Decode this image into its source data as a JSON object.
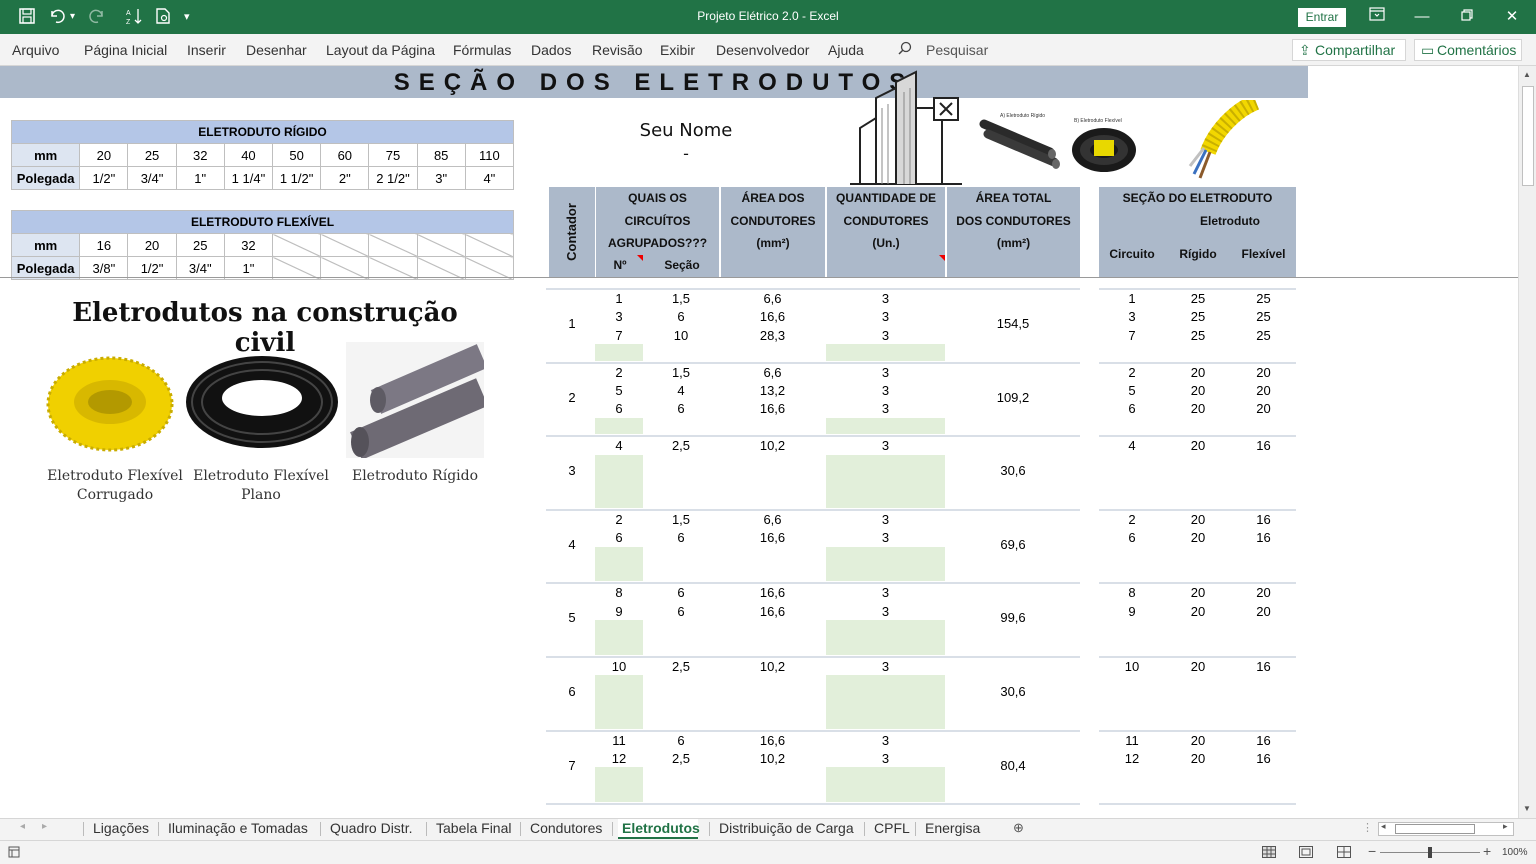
{
  "app": {
    "title": "Projeto Elétrico 2.0  -  Excel",
    "login_label": "Entrar"
  },
  "ribbon": {
    "items": [
      "Arquivo",
      "Página Inicial",
      "Inserir",
      "Desenhar",
      "Layout da Página",
      "Fórmulas",
      "Dados",
      "Revisão",
      "Exibir",
      "Desenvolvedor",
      "Ajuda"
    ],
    "search_label": "Pesquisar",
    "share_label": "Compartilhar",
    "comments_label": "Comentários"
  },
  "sheet": {
    "banner": "SEÇÃO DOS ELETRODUTOS",
    "seu_nome": "Seu Nome",
    "seu_nome_sub": "-",
    "rigido": {
      "title": "ELETRODUTO RÍGIDO",
      "mm_label": "mm",
      "pol_label": "Polegada",
      "mm": [
        "20",
        "25",
        "32",
        "40",
        "50",
        "60",
        "75",
        "85",
        "110"
      ],
      "pol": [
        "1/2\"",
        "3/4\"",
        "1\"",
        "1 1/4\"",
        "1 1/2\"",
        "2\"",
        "2 1/2\"",
        "3\"",
        "4\""
      ]
    },
    "flexivel": {
      "title": "ELETRODUTO FLEXÍVEL",
      "mm_label": "mm",
      "pol_label": "Polegada",
      "mm": [
        "16",
        "20",
        "25",
        "32"
      ],
      "pol": [
        "3/8\"",
        "1/2\"",
        "3/4\"",
        "1\""
      ]
    },
    "construcao": {
      "title": "Eletrodutos na construção civil",
      "caption1a": "Eletroduto Flexível",
      "caption1b": "Corrugado",
      "caption2a": "Eletroduto Flexível",
      "caption2b": "Plano",
      "caption3": "Eletroduto Rígido"
    },
    "photo_labels": {
      "rigido": "A) Eletroduto Rígido",
      "flexivel": "B) Eletroduto Flexível"
    },
    "headers": {
      "contador": "Contador",
      "quais_1": "QUAIS OS",
      "quais_2": "CIRCUÍTOS",
      "quais_3": "AGRUPADOS???",
      "num": "Nº",
      "secao": "Seção",
      "area_1": "ÁREA DOS",
      "area_2": "CONDUTORES",
      "area_3": "(mm²)",
      "qtd_1": "QUANTIDADE DE",
      "qtd_2": "CONDUTORES",
      "qtd_3": "(Un.)",
      "total_1": "ÁREA TOTAL",
      "total_2": "DOS CONDUTORES",
      "total_3": "(mm²)",
      "secao_eletroduto": "SEÇÃO DO ELETRODUTO",
      "eletroduto": "Eletroduto",
      "circuito": "Circuito",
      "rigido": "Rígido",
      "flexivel": "Flexível"
    },
    "groups": [
      {
        "contador": "1",
        "total": "154,5",
        "rows": [
          [
            "1",
            "1,5",
            "6,6",
            "3"
          ],
          [
            "3",
            "6",
            "16,6",
            "3"
          ],
          [
            "7",
            "10",
            "28,3",
            "3"
          ]
        ],
        "sec": [
          [
            "1",
            "25",
            "25"
          ],
          [
            "3",
            "25",
            "25"
          ],
          [
            "7",
            "25",
            "25"
          ]
        ]
      },
      {
        "contador": "2",
        "total": "109,2",
        "rows": [
          [
            "2",
            "1,5",
            "6,6",
            "3"
          ],
          [
            "5",
            "4",
            "13,2",
            "3"
          ],
          [
            "6",
            "6",
            "16,6",
            "3"
          ]
        ],
        "sec": [
          [
            "2",
            "20",
            "20"
          ],
          [
            "5",
            "20",
            "20"
          ],
          [
            "6",
            "20",
            "20"
          ]
        ]
      },
      {
        "contador": "3",
        "total": "30,6",
        "rows": [
          [
            "4",
            "2,5",
            "10,2",
            "3"
          ]
        ],
        "sec": [
          [
            "4",
            "20",
            "16"
          ]
        ]
      },
      {
        "contador": "4",
        "total": "69,6",
        "rows": [
          [
            "2",
            "1,5",
            "6,6",
            "3"
          ],
          [
            "6",
            "6",
            "16,6",
            "3"
          ]
        ],
        "sec": [
          [
            "2",
            "20",
            "16"
          ],
          [
            "6",
            "20",
            "16"
          ]
        ]
      },
      {
        "contador": "5",
        "total": "99,6",
        "rows": [
          [
            "8",
            "6",
            "16,6",
            "3"
          ],
          [
            "9",
            "6",
            "16,6",
            "3"
          ]
        ],
        "sec": [
          [
            "8",
            "20",
            "20"
          ],
          [
            "9",
            "20",
            "20"
          ]
        ]
      },
      {
        "contador": "6",
        "total": "30,6",
        "rows": [
          [
            "10",
            "2,5",
            "10,2",
            "3"
          ]
        ],
        "sec": [
          [
            "10",
            "20",
            "16"
          ]
        ]
      },
      {
        "contador": "7",
        "total": "80,4",
        "rows": [
          [
            "11",
            "6",
            "16,6",
            "3"
          ],
          [
            "12",
            "2,5",
            "10,2",
            "3"
          ]
        ],
        "sec": [
          [
            "11",
            "20",
            "16"
          ],
          [
            "12",
            "20",
            "16"
          ]
        ]
      }
    ]
  },
  "tabs": {
    "items": [
      "Ligações",
      "Iluminação e Tomadas",
      "Quadro Distr.",
      "Tabela Final",
      "Condutores",
      "Eletrodutos",
      "Distribuição de Carga",
      "CPFL",
      "Energisa"
    ],
    "active": "Eletrodutos"
  },
  "status": {
    "zoom": "100%"
  },
  "colors": {
    "excel_green": "#217346",
    "header_blue": "#acb9ca",
    "light_green": "#e2efda"
  }
}
